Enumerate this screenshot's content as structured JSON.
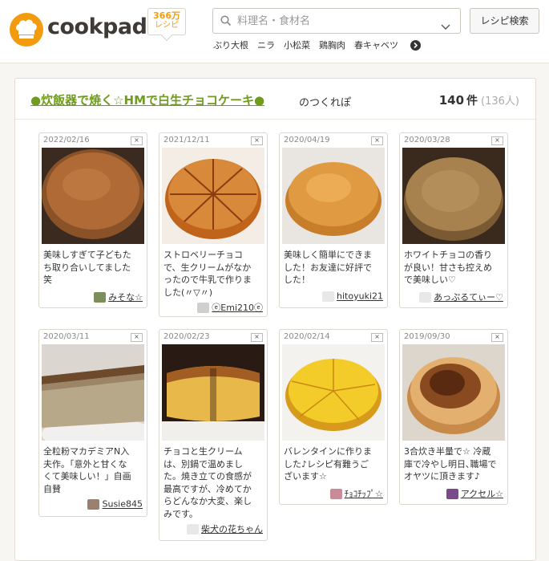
{
  "header": {
    "logo": "cookpad",
    "badge_count": "366万",
    "badge_unit": "レシピ",
    "search_placeholder": "料理名・食材名",
    "search_button": "レシピ検索",
    "keywords": [
      "ぶり大根",
      "ニラ",
      "小松菜",
      "鶏胸肉",
      "春キャベツ"
    ]
  },
  "main": {
    "recipe_title": "●炊飯器で焼く☆HMで白生チョコケーキ●",
    "suffix": "のつくれぽ",
    "count": "140",
    "count_unit": "件",
    "count_sub": "(136人)"
  },
  "cards": [
    {
      "date": "2022/02/16",
      "close": "×",
      "text": [
        "美味しすぎて子どもた",
        "ち取り合いしてました",
        "笑"
      ],
      "user": "みそな☆",
      "avatar_color": "#7c8f5a"
    },
    {
      "date": "2021/12/11",
      "close": "×",
      "text": [
        "ストロベリーチョコ",
        "で、生クリームがなか",
        "ったので牛乳で作りま",
        "した(〃▽〃)"
      ],
      "user": "ⓔEmi210ⓔ",
      "avatar_color": "#cfcfcf"
    },
    {
      "date": "2020/04/19",
      "close": "×",
      "text": [
        "美味しく簡単にできま",
        "した！お友達に好評で",
        "した！"
      ],
      "user": "hitoyuki21",
      "avatar_color": "#e8e8e8"
    },
    {
      "date": "2020/03/28",
      "close": "×",
      "text": [
        "ホワイトチョコの香り",
        "が良い！甘さも控えめ",
        "で美味しい♡"
      ],
      "user": "あっぷるてぃー♡",
      "avatar_color": "#e8e8e8"
    },
    {
      "date": "2020/03/11",
      "close": "×",
      "text": [
        "全粒粉マカデミアN入",
        "夫作。「意外と甘くな",
        "くて美味しい！」自画",
        "自賛"
      ],
      "user": "Susie845",
      "avatar_color": "#9a8070"
    },
    {
      "date": "2020/02/23",
      "close": "×",
      "text": [
        "チョコと生クリーム",
        "は、別鍋で温めまし",
        "た。焼き立ての食感が",
        "最高ですが、冷めてか",
        "らどんなか大変、楽し",
        "みです。"
      ],
      "user": "柴犬の花ちゃん",
      "avatar_color": "#e8e8e8"
    },
    {
      "date": "2020/02/14",
      "close": "×",
      "text": [
        "バレンタインに作りま",
        "した♪レシピ有難うご",
        "ざいます☆"
      ],
      "user": "ﾁｮｺﾁｯﾌﾟ☆",
      "avatar_color": "#c98a9a"
    },
    {
      "date": "2019/09/30",
      "close": "×",
      "text": [
        "3合炊き半量で☆ 冷蔵",
        "庫で冷やし明日､職場で",
        "オヤツに頂きます♪"
      ],
      "user": "アクセル☆",
      "avatar_color": "#7a4a8a"
    }
  ]
}
